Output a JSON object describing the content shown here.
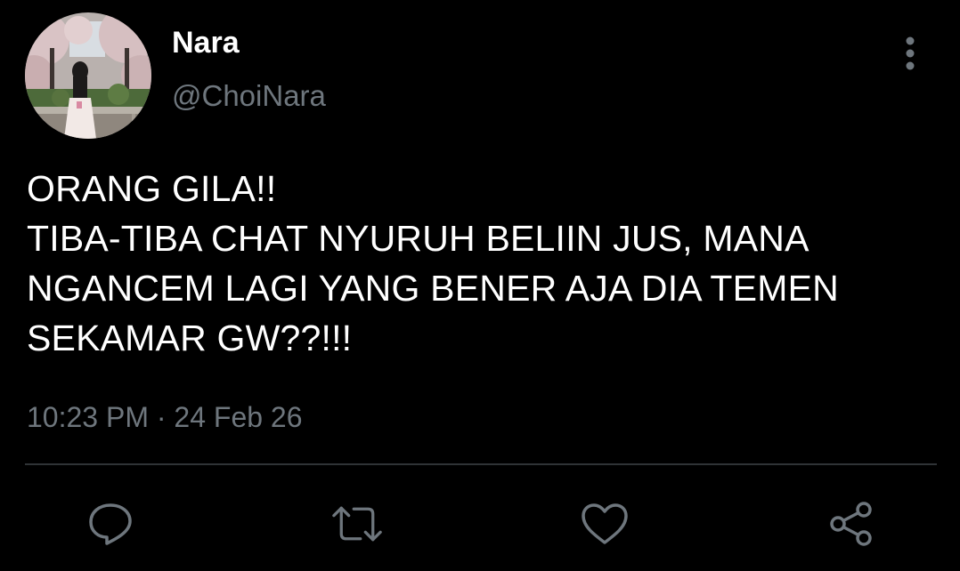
{
  "tweet": {
    "author": {
      "display_name": "Nara",
      "handle": "@ChoiNara",
      "avatar": "profile-photo-cherry-blossoms"
    },
    "text_lines": [
      "ORANG GILA!!",
      "TIBA-TIBA CHAT NYURUH BELIIN JUS, MANA",
      "NGANCEM LAGI YANG BENER AJA DIA TEMEN",
      "SEKAMAR GW??!!!"
    ],
    "timestamp": "10:23 PM · 24 Feb 26"
  },
  "actions": {
    "more": "more-vertical-icon",
    "reply": "reply-icon",
    "retweet": "retweet-icon",
    "like": "heart-icon",
    "share": "share-icon"
  },
  "colors": {
    "background": "#000000",
    "primary_text": "#ffffff",
    "secondary_text": "#6e767d",
    "divider": "#2f3336",
    "icon": "#6e767d"
  }
}
